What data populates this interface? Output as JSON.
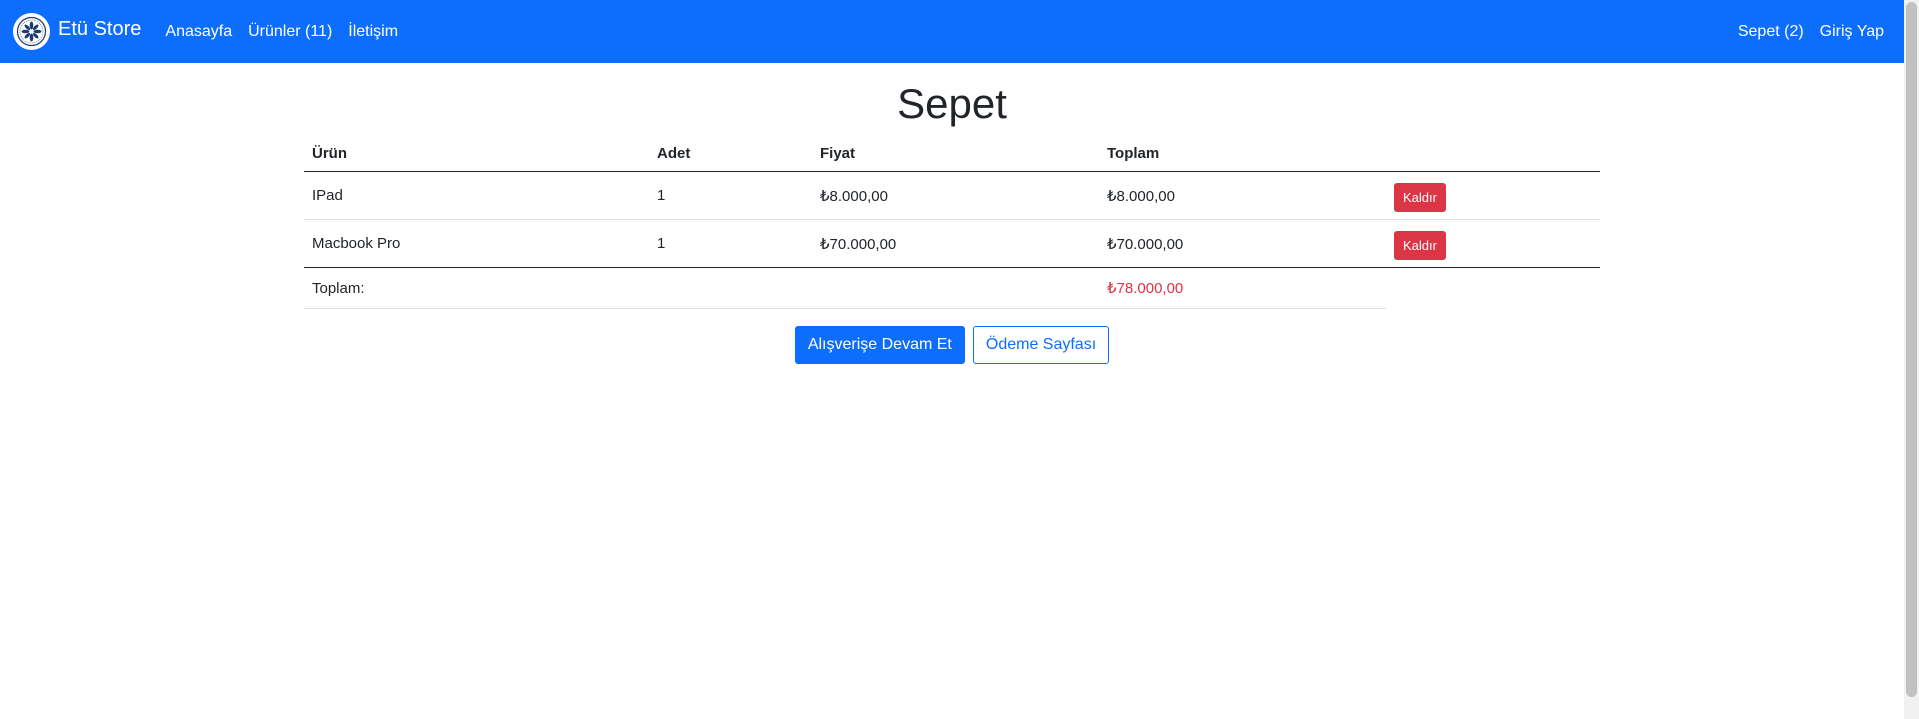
{
  "navbar": {
    "brand": "Etü Store",
    "links": {
      "home": "Anasayfa",
      "products": "Ürünler (11)",
      "contact": "İletişim"
    },
    "right": {
      "cart": "Sepet (2)",
      "login": "Giriş Yap"
    },
    "background_color": "#0d6efd"
  },
  "page": {
    "title": "Sepet"
  },
  "cart_table": {
    "headers": {
      "product": "Ürün",
      "quantity": "Adet",
      "price": "Fiyat",
      "total": "Toplam"
    },
    "rows": [
      {
        "product": "IPad",
        "quantity": "1",
        "price": "₺8.000,00",
        "total": "₺8.000,00",
        "remove_label": "Kaldır"
      },
      {
        "product": "Macbook Pro",
        "quantity": "1",
        "price": "₺70.000,00",
        "total": "₺70.000,00",
        "remove_label": "Kaldır"
      }
    ],
    "footer": {
      "label": "Toplam:",
      "grand_total": "₺78.000,00"
    }
  },
  "actions": {
    "continue_shopping": "Alışverişe Devam Et",
    "checkout": "Ödeme Sayfası"
  },
  "colors": {
    "primary": "#0d6efd",
    "danger": "#dc3545"
  }
}
